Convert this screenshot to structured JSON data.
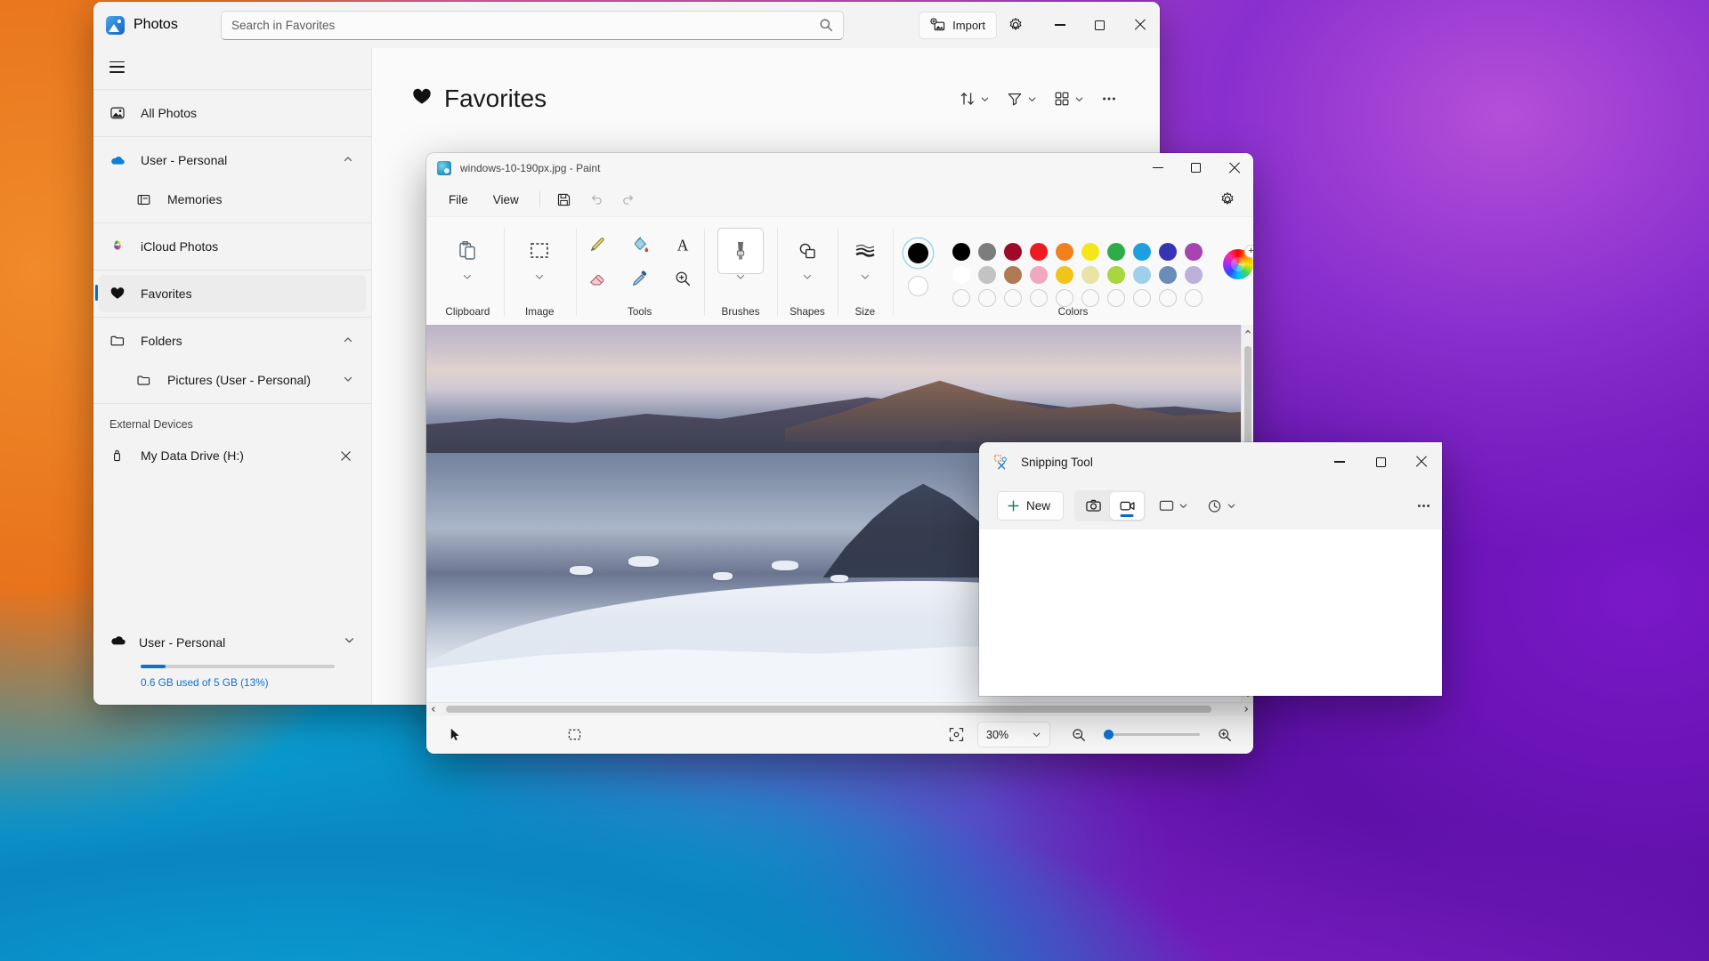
{
  "photos": {
    "app_name": "Photos",
    "logo_icon": "photos-app-icon",
    "search": {
      "placeholder": "Search in Favorites",
      "value": "",
      "icon": "search-icon"
    },
    "import_label": "Import",
    "import_icon": "import-photo-icon",
    "settings_icon": "gear-icon",
    "window_controls": {
      "minimize": "minimize-icon",
      "maximize": "maximize-icon",
      "close": "close-icon"
    },
    "menu_icon": "hamburger-menu-icon",
    "nav": [
      {
        "label": "All Photos",
        "icon": "all-photos-icon",
        "indent": false,
        "selected": false,
        "chevron": ""
      },
      {
        "label": "User - Personal",
        "icon": "onedrive-cloud-icon",
        "indent": false,
        "selected": false,
        "chevron": "chevron-up-icon"
      },
      {
        "label": "Memories",
        "icon": "memories-icon",
        "indent": true,
        "selected": false,
        "chevron": ""
      },
      {
        "label": "iCloud Photos",
        "icon": "icloud-photos-icon",
        "indent": false,
        "selected": false,
        "chevron": ""
      },
      {
        "label": "Favorites",
        "icon": "heart-icon",
        "indent": false,
        "selected": true,
        "chevron": ""
      },
      {
        "label": "Folders",
        "icon": "folder-icon",
        "indent": false,
        "selected": false,
        "chevron": "chevron-up-icon"
      },
      {
        "label": "Pictures (User - Personal)",
        "icon": "folder-icon",
        "indent": true,
        "selected": false,
        "chevron": "chevron-down-icon"
      }
    ],
    "external_devices": {
      "section_label": "External Devices",
      "device_label": "My Data Drive (H:)",
      "device_icon": "usb-drive-icon",
      "remove_icon": "close-icon"
    },
    "storage": {
      "account": "User - Personal",
      "icon": "onedrive-cloud-filled-icon",
      "chevron": "chevron-down-icon",
      "usage_text": "0.6 GB used of 5 GB (13%)",
      "percent": 13,
      "accent_color": "#1170cf"
    },
    "content": {
      "title": "Favorites",
      "title_icon": "heart-icon",
      "tools": [
        {
          "name": "sort-button",
          "icon": "sort-icon",
          "chevron": true
        },
        {
          "name": "filter-button",
          "icon": "filter-icon",
          "chevron": true
        },
        {
          "name": "view-layout-button",
          "icon": "grid-view-icon",
          "chevron": true
        },
        {
          "name": "more-options-button",
          "icon": "ellipsis-icon",
          "chevron": false
        }
      ]
    }
  },
  "paint": {
    "title": "windows-10-190px.jpg - Paint",
    "logo_icon": "paint-app-icon",
    "window_controls": {
      "minimize": "minimize-icon",
      "maximize": "maximize-icon",
      "close": "close-icon"
    },
    "menu": [
      {
        "label": "File",
        "name": "file-menu"
      },
      {
        "label": "View",
        "name": "view-menu"
      }
    ],
    "quick_actions": [
      {
        "name": "save-button",
        "icon": "save-icon"
      },
      {
        "name": "undo-button",
        "icon": "undo-icon"
      },
      {
        "name": "redo-button",
        "icon": "redo-icon"
      }
    ],
    "settings_icon": "gear-icon",
    "ribbon_groups": [
      {
        "label": "Clipboard",
        "name": "clipboard-group",
        "icon": "clipboard-icon"
      },
      {
        "label": "Image",
        "name": "image-group",
        "icon": "selection-icon"
      },
      {
        "label": "Tools",
        "name": "tools-group",
        "tools": [
          {
            "name": "pencil-tool",
            "icon": "pencil-icon"
          },
          {
            "name": "fill-tool",
            "icon": "paint-bucket-icon"
          },
          {
            "name": "text-tool",
            "icon": "text-a-icon"
          },
          {
            "name": "eraser-tool",
            "icon": "eraser-icon"
          },
          {
            "name": "color-picker-tool",
            "icon": "eyedropper-icon"
          },
          {
            "name": "magnifier-tool",
            "icon": "magnifier-icon"
          }
        ]
      },
      {
        "label": "Brushes",
        "name": "brushes-group",
        "icon": "brush-icon"
      },
      {
        "label": "Shapes",
        "name": "shapes-group",
        "icon": "shapes-icon"
      },
      {
        "label": "Size",
        "name": "size-group",
        "icon": "line-size-icon"
      },
      {
        "label": "Colors",
        "name": "colors-group"
      }
    ],
    "colors": {
      "primary": "#000000",
      "secondary": "#ffffff",
      "row1": [
        "#000000",
        "#7d7d7d",
        "#9e0b26",
        "#ed1c24",
        "#f2801f",
        "#f5e619",
        "#2fab4a",
        "#1e9fe0",
        "#3734b4",
        "#a844b0"
      ],
      "row2": [
        "#ffffff",
        "#c3c3c3",
        "#b07a55",
        "#f2a6bf",
        "#f0c419",
        "#e8e4a8",
        "#a8d63c",
        "#9ed0ea",
        "#6b8cb8",
        "#bdb0dd"
      ],
      "row3": [
        "",
        "",
        "",
        "",
        "",
        "",
        "",
        "",
        "",
        ""
      ],
      "wheel_icon": "color-wheel-icon",
      "add_icon": "plus-icon"
    },
    "statusbar": {
      "cursor_icon": "cursor-arrow-icon",
      "selection_icon": "selection-size-icon",
      "fit_icon": "fit-to-window-icon",
      "zoom_value": "30%",
      "zoom_chevron": "chevron-down-icon",
      "zoom_out_icon": "zoom-out-icon",
      "zoom_in_icon": "zoom-in-icon",
      "slider_position": 0
    },
    "scrollbars": {
      "vertical": "vertical-scrollbar",
      "horizontal": "horizontal-scrollbar"
    }
  },
  "snipping_tool": {
    "title": "Snipping Tool",
    "logo_icon": "snipping-tool-app-icon",
    "new_label": "New",
    "new_icon": "plus-icon",
    "modes": [
      {
        "name": "screenshot-mode-button",
        "icon": "camera-icon",
        "active": false
      },
      {
        "name": "video-record-mode-button",
        "icon": "video-camera-icon",
        "active": true
      }
    ],
    "shape_dropdown": {
      "name": "snip-shape-dropdown",
      "icon": "rectangle-snip-icon",
      "chevron": "chevron-down-icon"
    },
    "delay_dropdown": {
      "name": "snip-delay-dropdown",
      "icon": "clock-delay-icon",
      "chevron": "chevron-down-icon"
    },
    "more_icon": "ellipsis-icon",
    "window_controls": {
      "minimize": "minimize-icon",
      "maximize": "maximize-icon",
      "close": "close-icon"
    }
  }
}
